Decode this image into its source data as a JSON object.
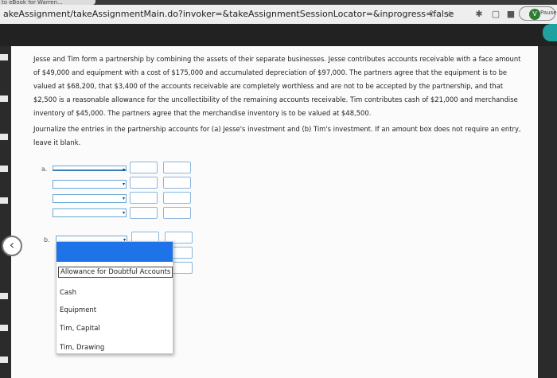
{
  "browser": {
    "tab_title": "to eBook for Warren...",
    "url": "akeAssignment/takeAssignmentMain.do?invoker=&takeAssignmentSessionLocator=&inprogress=false",
    "profile_initial": "V",
    "paused_label": "Paused"
  },
  "question": {
    "paragraph1": "Jesse and Tim form a partnership by combining the assets of their separate businesses. Jesse contributes accounts receivable with a face amount of $49,000 and equipment with a cost of $175,000 and accumulated depreciation of $97,000. The partners agree that the equipment is to be valued at $68,200, that $3,400 of the accounts receivable are completely worthless and are not to be accepted by the partnership, and that $2,500 is a reasonable allowance for the uncollectibility of the remaining accounts receivable. Tim contributes cash of $21,000 and merchandise inventory of $45,000. The partners agree that the merchandise inventory is to be valued at $48,500.",
    "paragraph2": "Journalize the entries in the partnership accounts for (a) Jesse's investment and (b) Tim's investment. If an amount box does not require an entry, leave it blank."
  },
  "journal": {
    "label_a": "a.",
    "label_b": "b."
  },
  "dropdown": {
    "options": [
      "Allowance for Doubtful Accounts",
      "Cash",
      "Equipment",
      "Tim, Capital",
      "Tim, Drawing"
    ]
  },
  "icons": {
    "back": "chevron-left-icon",
    "help": "question-icon"
  },
  "colors": {
    "accent_blue": "#1e73e8",
    "teal": "#21a0a0"
  }
}
